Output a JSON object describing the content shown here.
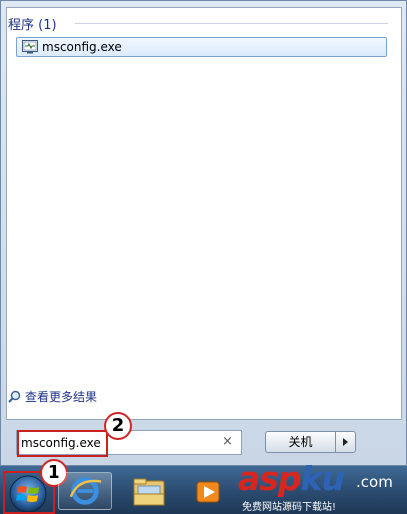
{
  "results": {
    "group_header": "程序 (1)",
    "item_label": "msconfig.exe",
    "see_more": "查看更多结果"
  },
  "search": {
    "value": "msconfig.exe",
    "clear_glyph": "×"
  },
  "shutdown": {
    "label": "关机"
  },
  "callouts": {
    "one": "1",
    "two": "2"
  },
  "watermark": {
    "brand_red": "asp",
    "brand_blue": "ku",
    "tld": ".com",
    "caption": "免费网站源码下载站!"
  },
  "taskbar": {
    "icons": [
      "windows-logo-icon",
      "internet-explorer-icon",
      "windows-explorer-icon",
      "media-player-icon"
    ]
  },
  "colors": {
    "highlight": "#cc1f1f",
    "header_text": "#1e3287"
  }
}
